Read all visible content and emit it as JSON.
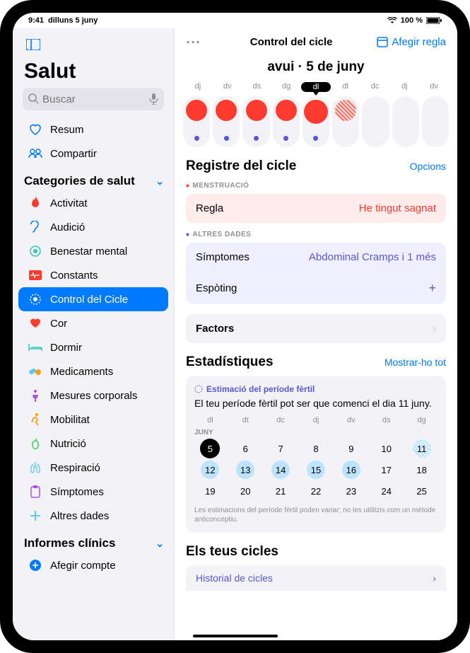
{
  "status": {
    "time": "9:41",
    "date": "dilluns 5 juny",
    "battery": "100 %"
  },
  "app_title": "Salut",
  "search": {
    "placeholder": "Buscar"
  },
  "sidebar": {
    "summary": "Resum",
    "share": "Compartir",
    "categories_header": "Categories de salut",
    "items": [
      "Activitat",
      "Audició",
      "Benestar mental",
      "Constants",
      "Control del Cicle",
      "Cor",
      "Dormir",
      "Medicaments",
      "Mesures corporals",
      "Mobilitat",
      "Nutrició",
      "Respiració",
      "Símptomes",
      "Altres dades"
    ],
    "clinical_header": "Informes clínics",
    "add_account": "Afegir compte"
  },
  "header": {
    "title": "Control del cicle",
    "add": "Afegir regla"
  },
  "date_label": "avui · 5 de juny",
  "week_days": [
    "dj",
    "dv",
    "ds",
    "dg",
    "dl",
    "dt",
    "dc",
    "dj",
    "dv"
  ],
  "log": {
    "title": "Registre del cicle",
    "options": "Opcions",
    "menstruation_label": "MENSTRUACIÓ",
    "period": "Regla",
    "period_val": "He tingut sagnat",
    "other_label": "ALTRES DADES",
    "symptoms": "Símptomes",
    "symptoms_val": "Abdominal Cramps i 1 més",
    "spotting": "Espòting",
    "factors": "Factors"
  },
  "stats": {
    "title": "Estadístiques",
    "show_all": "Mostrar-ho tot",
    "fertile_label": "Estimació del període fèrtil",
    "fertile_text": "El teu període fèrtil pot ser que comenci el dia 11 juny.",
    "cal_days": [
      "dl",
      "dt",
      "dc",
      "dj",
      "dv",
      "ds",
      "dg"
    ],
    "month": "JUNY",
    "weeks": [
      [
        5,
        6,
        7,
        8,
        9,
        10,
        11
      ],
      [
        12,
        13,
        14,
        15,
        16,
        17,
        18
      ],
      [
        19,
        20,
        21,
        22,
        23,
        24,
        25
      ]
    ],
    "disclaimer": "Les estimacions del període fèrtil poden variar; no les utilitzis com un mètode anticonceptiu."
  },
  "cycles": {
    "title": "Els teus cicles",
    "history": "Historial de cicles"
  }
}
